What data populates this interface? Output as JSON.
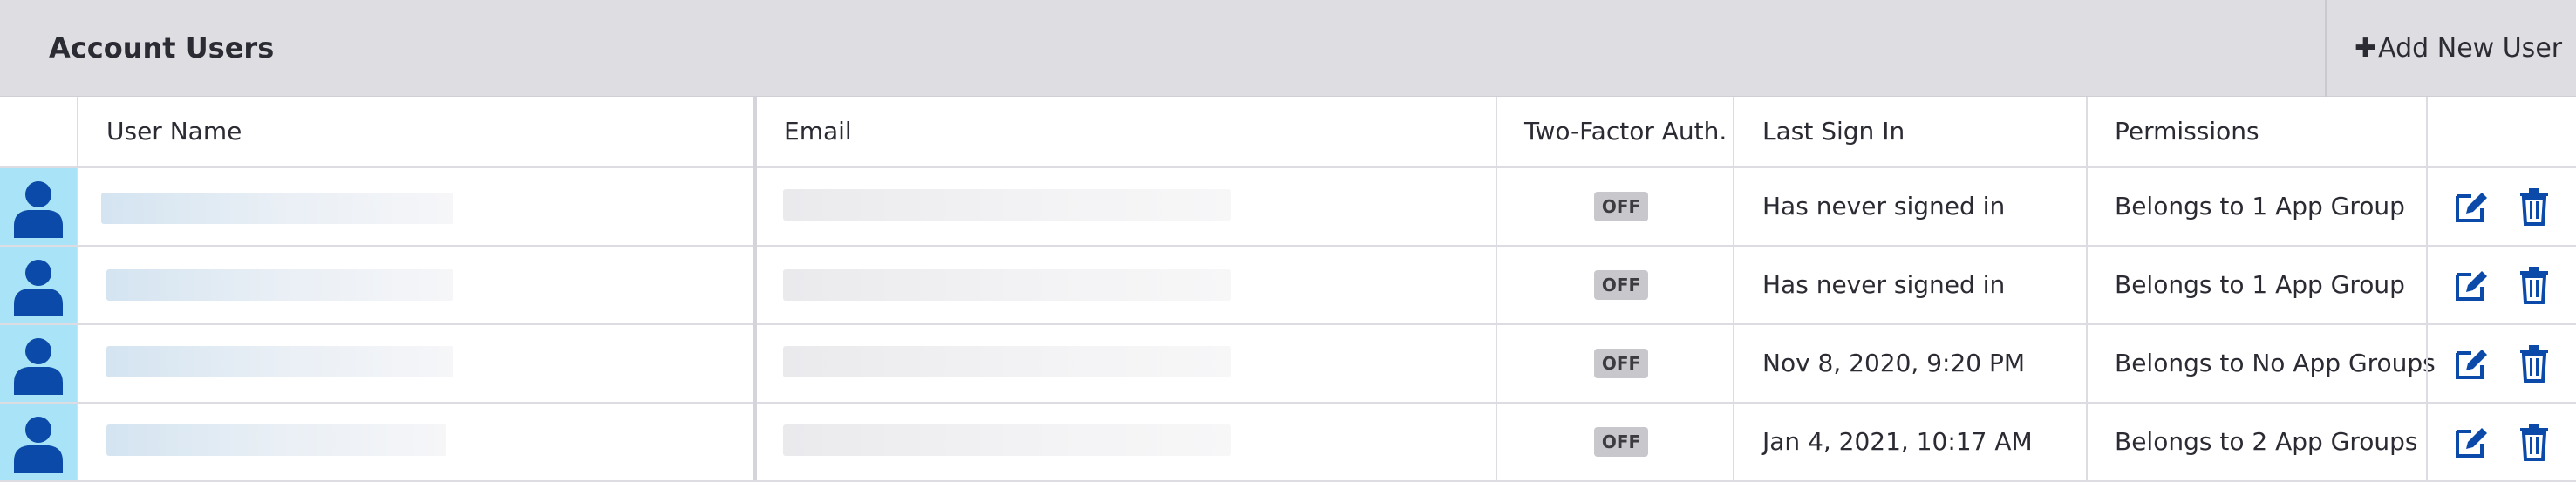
{
  "header": {
    "title": "Account Users",
    "add_button_label": "Add New User"
  },
  "columns": [
    "User Name",
    "Email",
    "Two-Factor Auth.",
    "Last Sign In",
    "Permissions"
  ],
  "rows": [
    {
      "two_factor": "OFF",
      "last_sign_in": "Has never signed in",
      "permissions": "Belongs to 1 App Group"
    },
    {
      "two_factor": "OFF",
      "last_sign_in": "Has never signed in",
      "permissions": "Belongs to 1 App Group"
    },
    {
      "two_factor": "OFF",
      "last_sign_in": "Nov 8, 2020, 9:20 PM",
      "permissions": "Belongs to No App Groups"
    },
    {
      "two_factor": "OFF",
      "last_sign_in": "Jan 4, 2021, 10:17 AM",
      "permissions": "Belongs to 2 App Groups"
    }
  ],
  "icons": {
    "add": "plus-icon",
    "avatar": "user-icon",
    "edit": "edit-icon",
    "delete": "trash-icon"
  },
  "colors": {
    "header_bg": "#dddde2",
    "avatar_bg": "#a9e3f7",
    "avatar_icon": "#0b4aa8",
    "action_icon": "#0b4aa8",
    "badge_bg": "#c7c7cc"
  }
}
